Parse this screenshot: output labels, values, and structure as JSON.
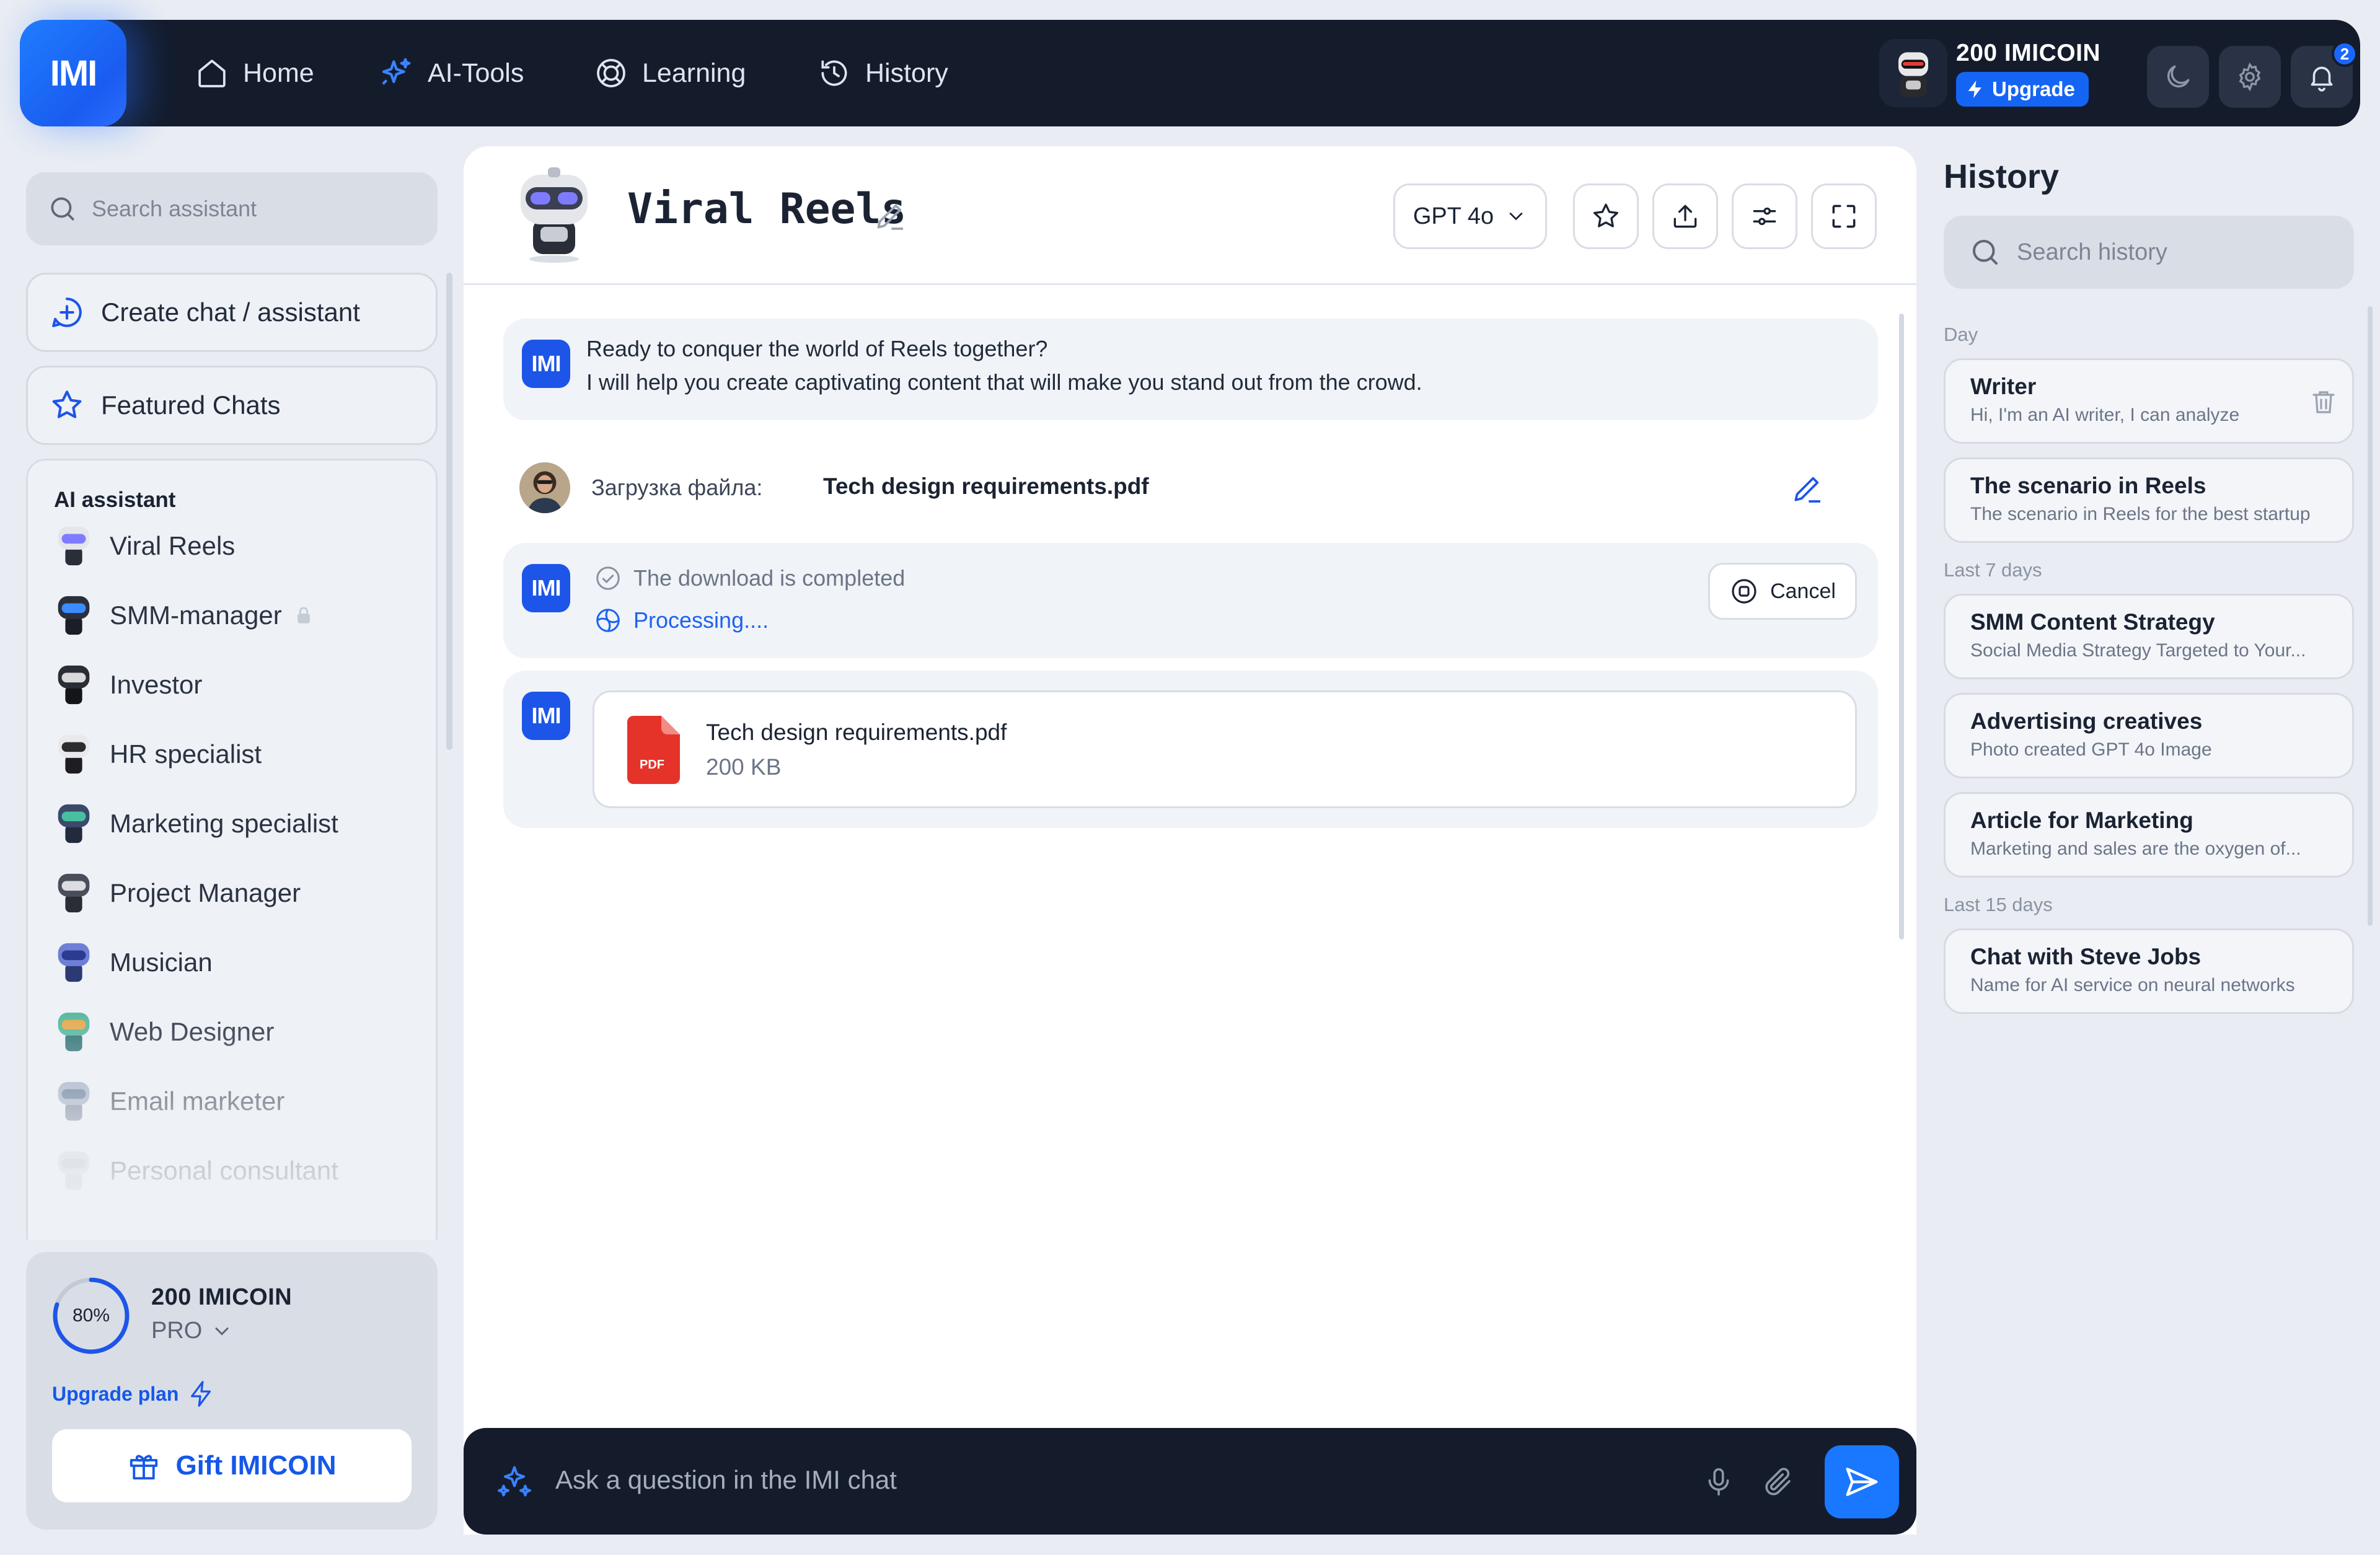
{
  "nav": {
    "logo": "IMI",
    "items": [
      {
        "label": "Home",
        "icon": "home-icon"
      },
      {
        "label": "AI-Tools",
        "icon": "sparkle-icon"
      },
      {
        "label": "Learning",
        "icon": "learning-icon"
      },
      {
        "label": "History",
        "icon": "history-icon"
      }
    ],
    "coins": "200 IMICOIN",
    "upgrade_label": "Upgrade",
    "notification_count": "2"
  },
  "sidebar": {
    "search_placeholder": "Search assistant",
    "create_label": "Create chat / assistant",
    "featured_label": "Featured Chats",
    "assistant_section_title": "AI assistant",
    "assistants": [
      {
        "label": "Viral Reels",
        "locked": false
      },
      {
        "label": "SMM-manager",
        "locked": true
      },
      {
        "label": "Investor",
        "locked": false
      },
      {
        "label": "HR specialist",
        "locked": false
      },
      {
        "label": "Marketing specialist",
        "locked": false
      },
      {
        "label": "Project Manager",
        "locked": false
      },
      {
        "label": "Musician",
        "locked": false
      },
      {
        "label": "Web Designer",
        "locked": false
      },
      {
        "label": "Email marketer",
        "locked": false
      },
      {
        "label": "Personal consultant",
        "locked": false
      }
    ],
    "plan": {
      "percent_label": "80%",
      "percent": 0.8,
      "coins": "200 IMICOIN",
      "tier": "PRO",
      "upgrade_label": "Upgrade plan",
      "gift_label": "Gift IMICOIN"
    }
  },
  "chat": {
    "title": "Viral Reels",
    "model": "GPT 4o",
    "greeting_line1": "Ready to conquer the world of Reels together?",
    "greeting_line2": "I will help you create captivating content that will make you stand out from the crowd.",
    "upload_label": "Загрузка файла:",
    "upload_file": "Tech design requirements.pdf",
    "status_done": "The download is completed",
    "status_processing": "Processing....",
    "cancel_label": "Cancel",
    "file_name": "Tech design requirements.pdf",
    "file_size": "200 KB",
    "file_type": "PDF",
    "input_placeholder": "Ask a question in the IMI chat",
    "badge": "IMI"
  },
  "history": {
    "title": "History",
    "search_placeholder": "Search history",
    "groups": [
      {
        "label": "Day",
        "items": [
          {
            "title": "Writer",
            "subtitle": "Hi, I'm an AI writer, I can analyze"
          },
          {
            "title": "The scenario in Reels",
            "subtitle": "The scenario in Reels for the best startup"
          }
        ]
      },
      {
        "label": "Last 7 days",
        "items": [
          {
            "title": "SMM Content Strategy",
            "subtitle": "Social Media Strategy Targeted to Your..."
          },
          {
            "title": "Advertising creatives",
            "subtitle": "Photo created GPT 4o Image"
          },
          {
            "title": "Article for Marketing",
            "subtitle": "Marketing and sales are the oxygen of..."
          }
        ]
      },
      {
        "label": "Last 15 days",
        "items": [
          {
            "title": "Chat with Steve Jobs",
            "subtitle": "Name for AI service on neural networks"
          }
        ]
      }
    ]
  },
  "colors": {
    "accent": "#1d55e8",
    "dark": "#141c2c",
    "background": "#e9edf3"
  }
}
